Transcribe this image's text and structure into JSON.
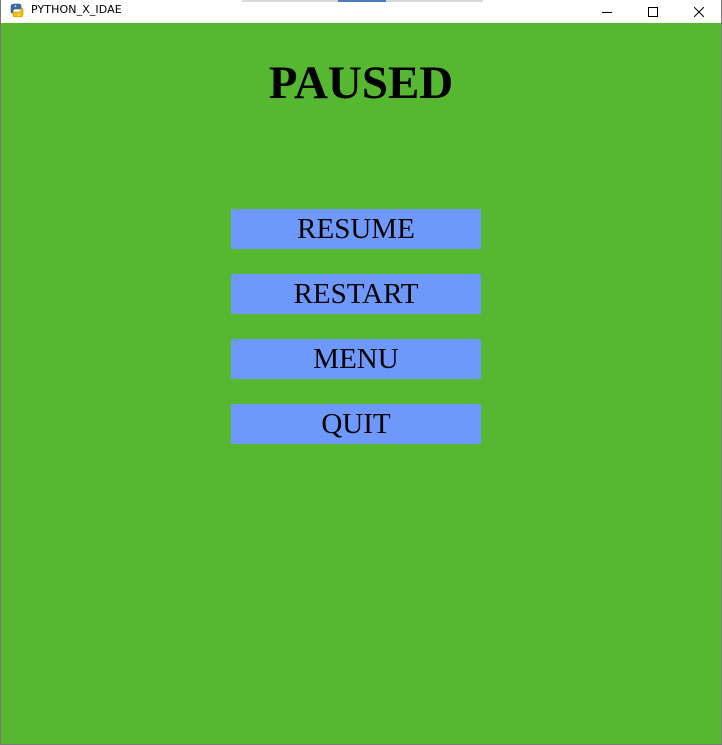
{
  "window": {
    "title": "PYTHON_X_IDAE",
    "app_icon": "python-icon",
    "controls": {
      "minimize_icon": "minimize-icon",
      "maximize_icon": "maximize-icon",
      "close_icon": "close-icon"
    }
  },
  "game": {
    "background_color": "#56b831",
    "title": "PAUSED",
    "buttons": [
      {
        "label": "RESUME"
      },
      {
        "label": "RESTART"
      },
      {
        "label": "MENU"
      },
      {
        "label": "QUIT"
      }
    ],
    "button_color": "#6e99fa"
  }
}
